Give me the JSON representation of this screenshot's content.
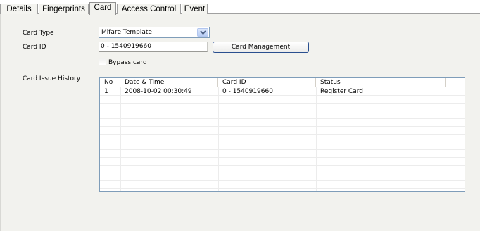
{
  "tabs": [
    {
      "label": "Details"
    },
    {
      "label": "Fingerprints"
    },
    {
      "label": "Card"
    },
    {
      "label": "Access Control"
    },
    {
      "label": "Event"
    }
  ],
  "active_tab": "Card",
  "form": {
    "card_type_label": "Card Type",
    "card_type_value": "Mifare Template",
    "card_id_label": "Card ID",
    "card_id_value": "0 - 1540919660",
    "card_management_button": "Card Management",
    "bypass_card_label": "Bypass card",
    "bypass_card_checked": false
  },
  "history": {
    "label": "Card Issue History",
    "columns": [
      "No",
      "Date & Time",
      "Card ID",
      "Status"
    ],
    "rows": [
      [
        "1",
        "2008-10-02 00:30:49",
        "0 - 1540919660",
        "Register Card"
      ]
    ]
  }
}
